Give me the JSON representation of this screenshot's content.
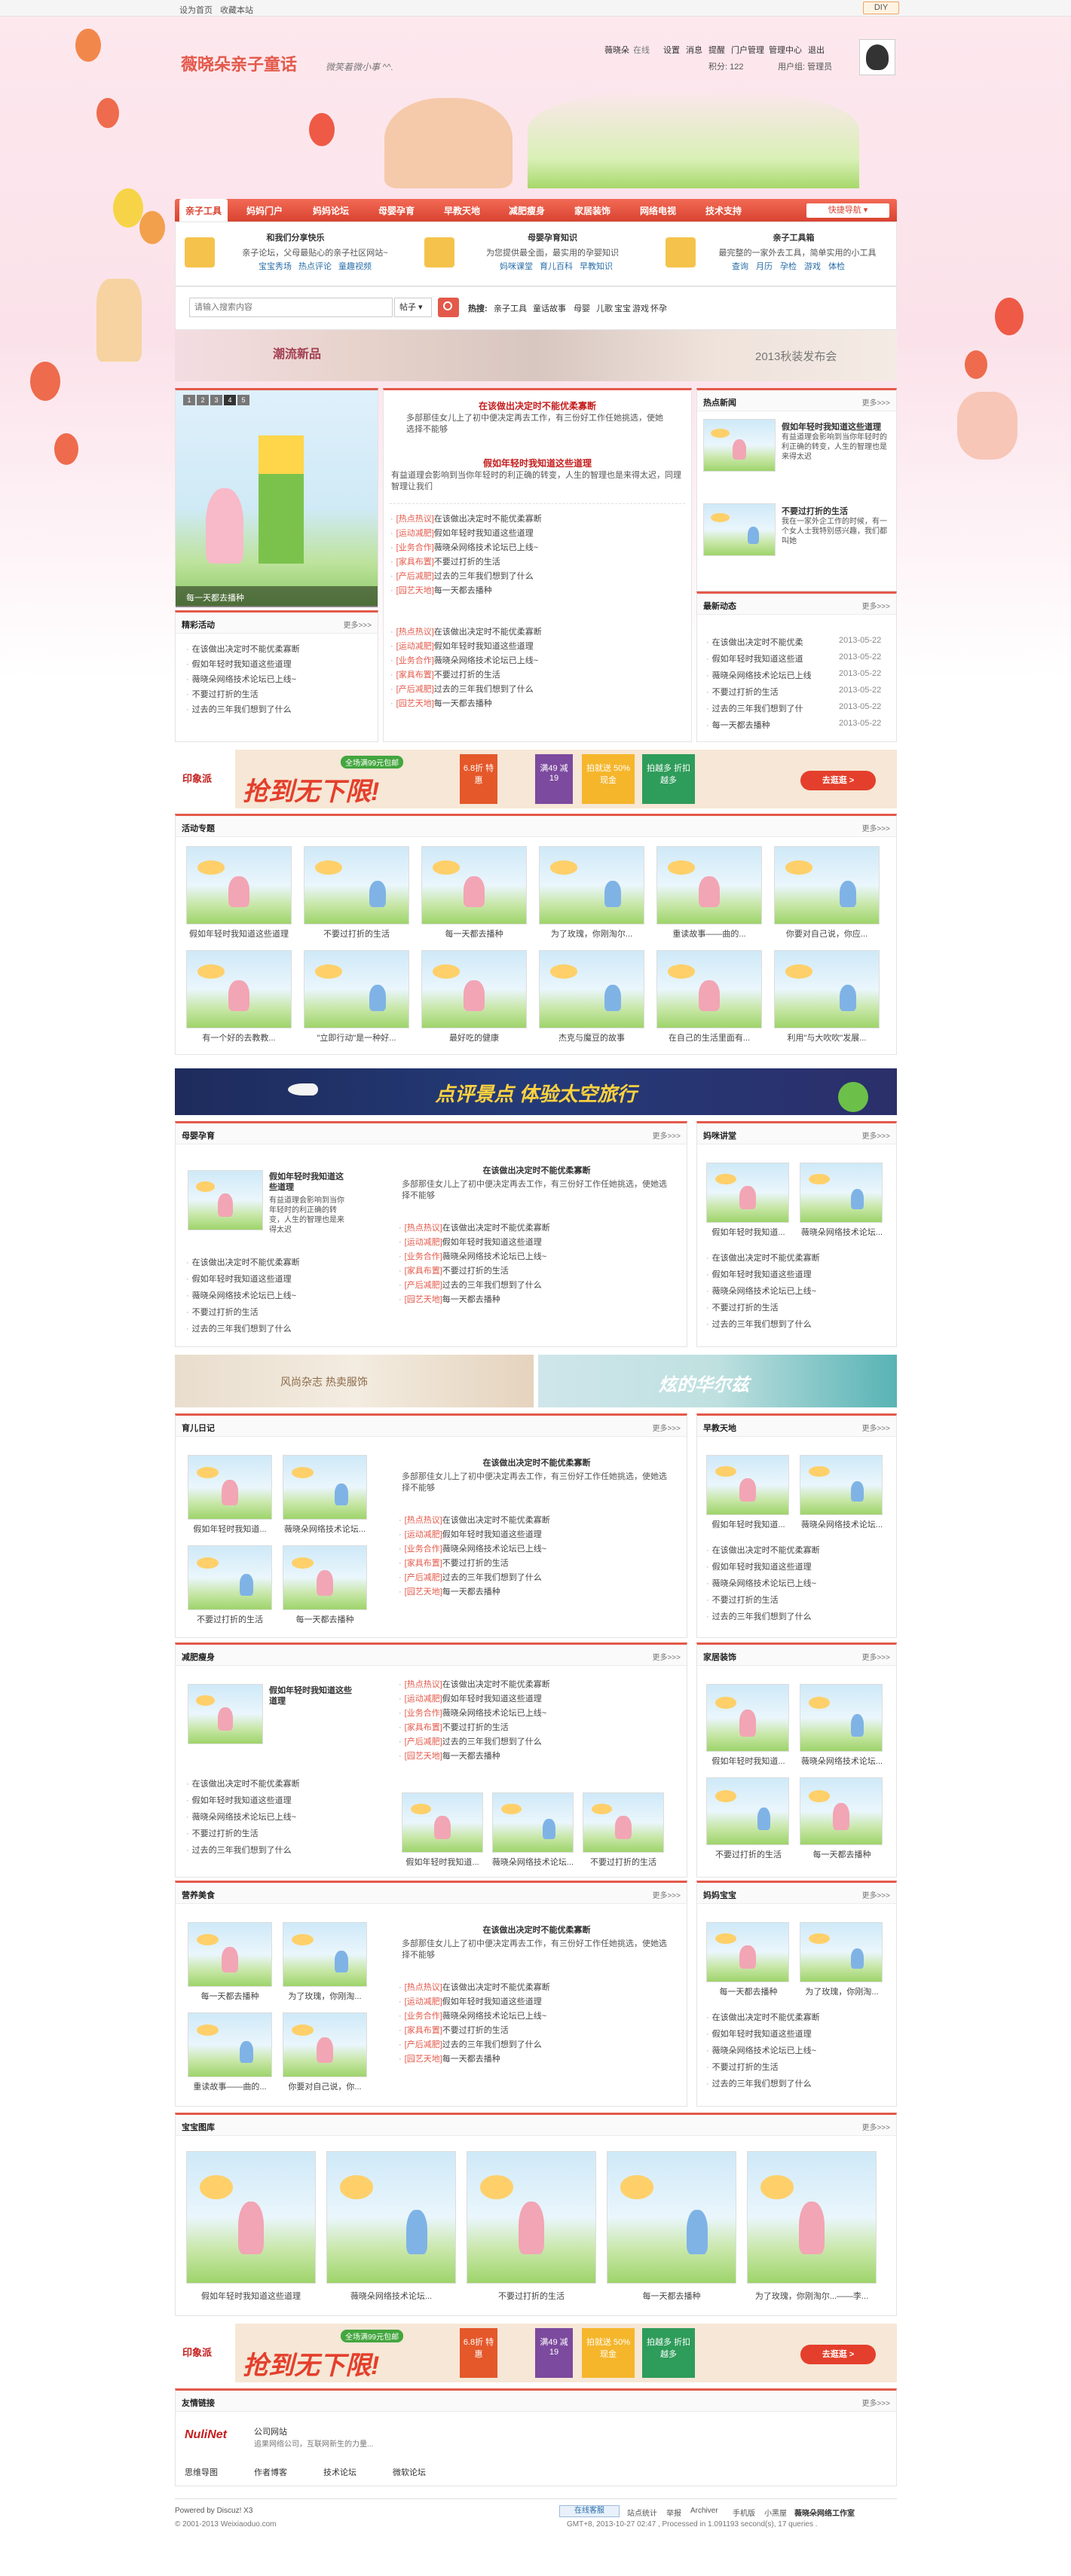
{
  "topbar": {
    "set_home": "设为首页",
    "bookmark": "收藏本站",
    "diy": "DIY"
  },
  "site": {
    "logo": "薇晓朵亲子童话",
    "slogan": "微笑着微小事 ^^."
  },
  "user": {
    "name": "薇晓朵",
    "status": "在线",
    "links": [
      "设置",
      "消息",
      "提醒",
      "门户管理",
      "管理中心",
      "退出"
    ],
    "points_label": "积分: 122",
    "group_label": "用户组: 管理员"
  },
  "nav": {
    "items": [
      "亲子工具",
      "妈妈门户",
      "妈妈论坛",
      "母婴孕育",
      "早教天地",
      "减肥瘦身",
      "家居装饰",
      "网络电视",
      "技术支持"
    ],
    "quick": "快捷导航"
  },
  "features": [
    {
      "title": "和我们分享快乐",
      "desc": "亲子论坛，父母最贴心的亲子社区网站~",
      "links": [
        "宝宝秀场",
        "热点评论",
        "童趣视频"
      ]
    },
    {
      "title": "母婴孕育知识",
      "desc": "为您提供最全面，最实用的孕婴知识",
      "links": [
        "妈咪课堂",
        "育儿百科",
        "早教知识"
      ]
    },
    {
      "title": "亲子工具箱",
      "desc": "最完整的一家外去工具，简单实用的小工具",
      "links": [
        "查询",
        "月历",
        "孕检",
        "游戏",
        "体检"
      ]
    }
  ],
  "search": {
    "placeholder": "请输入搜索内容",
    "type": "帖子",
    "hot_label": "热搜:",
    "hot": [
      "亲子工具",
      "童话故事",
      "母婴",
      "儿歌",
      "宝宝",
      "游戏",
      "怀孕"
    ]
  },
  "banner_top": {
    "left_text": "潮流新品",
    "right_text": "2013秋装发布会"
  },
  "slider": {
    "pages": [
      "1",
      "2",
      "3",
      "4",
      "5"
    ],
    "caption": "每一天都去播种"
  },
  "headline": {
    "title1": "在该做出决定时不能优柔寡断",
    "desc1": "多部那佳女儿上了初中便决定再去工作，有三份好工作任她挑选，使她选择不能够",
    "title2": "假如年轻时我知道这些道理",
    "desc2": "有益道理会影响到当你年轻时的利正确的转变，人生的智理也是来得太迟，同理智理让我们"
  },
  "tag_news1": [
    {
      "tag": "[热点热议]",
      "text": "在该做出决定时不能优柔寡断"
    },
    {
      "tag": "[运动减肥]",
      "text": "假如年轻时我知道这些道理"
    },
    {
      "tag": "[业务合作]",
      "text": "薇晓朵网络技术论坛已上线~"
    },
    {
      "tag": "[家具布置]",
      "text": "不要过打折的生活"
    },
    {
      "tag": "[产后减肥]",
      "text": "过去的三年我们想到了什么"
    },
    {
      "tag": "[园艺天地]",
      "text": "每一天都去播种"
    }
  ],
  "hot_news": {
    "title": "热点新闻",
    "more": "更多>>>",
    "items": [
      {
        "title": "假如年轻时我知道这些道理",
        "desc": "有益道理会影响到当你年轻时的利正确的转变，人生的智理也是来得太迟"
      },
      {
        "title": "不要过打折的生活",
        "desc": "我在一家外企工作的时候，有一个女人士我特别感兴趣，我们都叫她"
      }
    ]
  },
  "activity": {
    "title": "精彩活动",
    "more": "更多>>>",
    "items": [
      "在该做出决定时不能优柔寡断",
      "假如年轻时我知道这些道理",
      "薇晓朵网络技术论坛已上线~",
      "不要过打折的生活",
      "过去的三年我们想到了什么"
    ]
  },
  "latest": {
    "title": "最新动态",
    "more": "更多>>>",
    "items": [
      {
        "text": "在该做出决定时不能优柔",
        "date": "2013-05-22"
      },
      {
        "text": "假如年轻时我知道这些道",
        "date": "2013-05-22"
      },
      {
        "text": "薇晓朵网络技术论坛已上线",
        "date": "2013-05-22"
      },
      {
        "text": "不要过打折的生活",
        "date": "2013-05-22"
      },
      {
        "text": "过去的三年我们想到了什",
        "date": "2013-05-22"
      },
      {
        "text": "每一天都去播种",
        "date": "2013-05-22"
      }
    ]
  },
  "ad": {
    "brand": "印象派",
    "big": "抢到无下限!",
    "tag": "全场满99元包邮",
    "p1": "6.8折 特惠",
    "p2": "满49 减19",
    "p3": "拍就送 50%现金",
    "p4": "拍越多 折扣越多",
    "go": "去逛逛 >"
  },
  "topic": {
    "title": "活动专题",
    "more": "更多>>>",
    "row1": [
      "假如年轻时我知道这些道理",
      "不要过打折的生活",
      "每一天都去播种",
      "为了玫瑰，你刚淘尔...",
      "重读故事——曲的...",
      "你要对自己说，你应..."
    ],
    "row2": [
      "有一个好的去教教...",
      "\"立即行动\"是一种好...",
      "最好吃的健康",
      "杰克与魔豆的故事",
      "在自己的生活里面有...",
      "利用\"与大吹吹\"发展..."
    ]
  },
  "space_banner": {
    "text": "点评景点 体验太空旅行"
  },
  "muying": {
    "title": "母婴孕育",
    "more": "更多>>>",
    "pic_title": "假如年轻时我知道这些道理",
    "pic_desc": "有益道理会影响到当你年轻时的利正确的转变，人生的智理也是来得太迟",
    "list": [
      "在该做出决定时不能优柔寡断",
      "假如年轻时我知道这些道理",
      "薇晓朵网络技术论坛已上线~",
      "不要过打折的生活",
      "过去的三年我们想到了什么"
    ],
    "head_title": "在该做出决定时不能优柔寡断",
    "head_desc": "多部那佳女儿上了初中便决定再去工作，有三份好工作任她挑选，使她选择不能够"
  },
  "mama": {
    "title": "妈咪讲堂",
    "more": "更多>>>",
    "caps": [
      "假如年轻时我知道...",
      "薇晓朵网络技术论坛..."
    ],
    "list": [
      "在该做出决定时不能优柔寡断",
      "假如年轻时我知道这些道理",
      "薇晓朵网络技术论坛已上线~",
      "不要过打折的生活",
      "过去的三年我们想到了什么"
    ]
  },
  "banner2": {
    "left": "风尚杂志 热卖服饰",
    "right": "炫的华尔兹"
  },
  "yuer": {
    "title": "育儿日记",
    "more": "更多>>>",
    "caps": [
      "假如年轻时我知道...",
      "薇晓朵网络技术论坛...",
      "不要过打折的生活",
      "每一天都去播种"
    ]
  },
  "zaojiao": {
    "title": "早教天地",
    "more": "更多>>>",
    "caps": [
      "假如年轻时我知道...",
      "薇晓朵网络技术论坛..."
    ],
    "list": [
      "在该做出决定时不能优柔寡断",
      "假如年轻时我知道这些道理",
      "薇晓朵网络技术论坛已上线~",
      "不要过打折的生活",
      "过去的三年我们想到了什么"
    ]
  },
  "jianfei": {
    "title": "减肥瘦身",
    "more": "更多>>>",
    "pic_title": "假如年轻时我知道这些道理",
    "caps": [
      "假如年轻时我知道...",
      "薇晓朵网络技术论坛...",
      "不要过打折的生活"
    ],
    "list": [
      "在该做出决定时不能优柔寡断",
      "假如年轻时我知道这些道理",
      "薇晓朵网络技术论坛已上线~",
      "不要过打折的生活",
      "过去的三年我们想到了什么"
    ]
  },
  "jiaju": {
    "title": "家居装饰",
    "more": "更多>>>",
    "caps": [
      "假如年轻时我知道...",
      "薇晓朵网络技术论坛...",
      "不要过打折的生活",
      "每一天都去播种"
    ]
  },
  "yingyang": {
    "title": "营养美食",
    "more": "更多>>>",
    "caps": [
      "每一天都去播种",
      "为了玫瑰，你刚淘...",
      "重读故事——曲的...",
      "你要对自己说，你..."
    ]
  },
  "baobao": {
    "title": "妈妈宝宝",
    "more": "更多>>>",
    "caps": [
      "每一天都去播种",
      "为了玫瑰，你刚淘..."
    ],
    "list": [
      "在该做出决定时不能优柔寡断",
      "假如年轻时我知道这些道理",
      "薇晓朵网络技术论坛已上线~",
      "不要过打折的生活",
      "过去的三年我们想到了什么"
    ]
  },
  "gallery": {
    "title": "宝宝图库",
    "more": "更多>>>",
    "caps": [
      "假如年轻时我知道这些道理",
      "薇晓朵网络技术论坛...",
      "不要过打折的生活",
      "每一天都去播种",
      "为了玫瑰，你刚淘尔...——李..."
    ]
  },
  "friends": {
    "title": "友情链接",
    "more": "更多>>>",
    "logo": "NuliNet",
    "logo_title": "公司网站",
    "logo_desc": "追果网络公司，互联网新生的力量...",
    "links": [
      "思维导图",
      "作者博客",
      "技术论坛",
      "微软论坛"
    ]
  },
  "footer": {
    "powered": "Powered by Discuz! X3",
    "copy": "© 2001-2013 Weixiaoduo.com",
    "online": "在线客服",
    "links": [
      "站点统计",
      "举报",
      "Archiver",
      "手机版",
      "小黑屋",
      "薇晓朵网络工作室"
    ],
    "gmt": "GMT+8, 2013-10-27 02:47 , Processed in 1.091193 second(s), 17 queries ."
  },
  "colors": {
    "accent": "#e3594a",
    "title_red": "#c51d1d",
    "pink_bg": "#fde8ee"
  }
}
